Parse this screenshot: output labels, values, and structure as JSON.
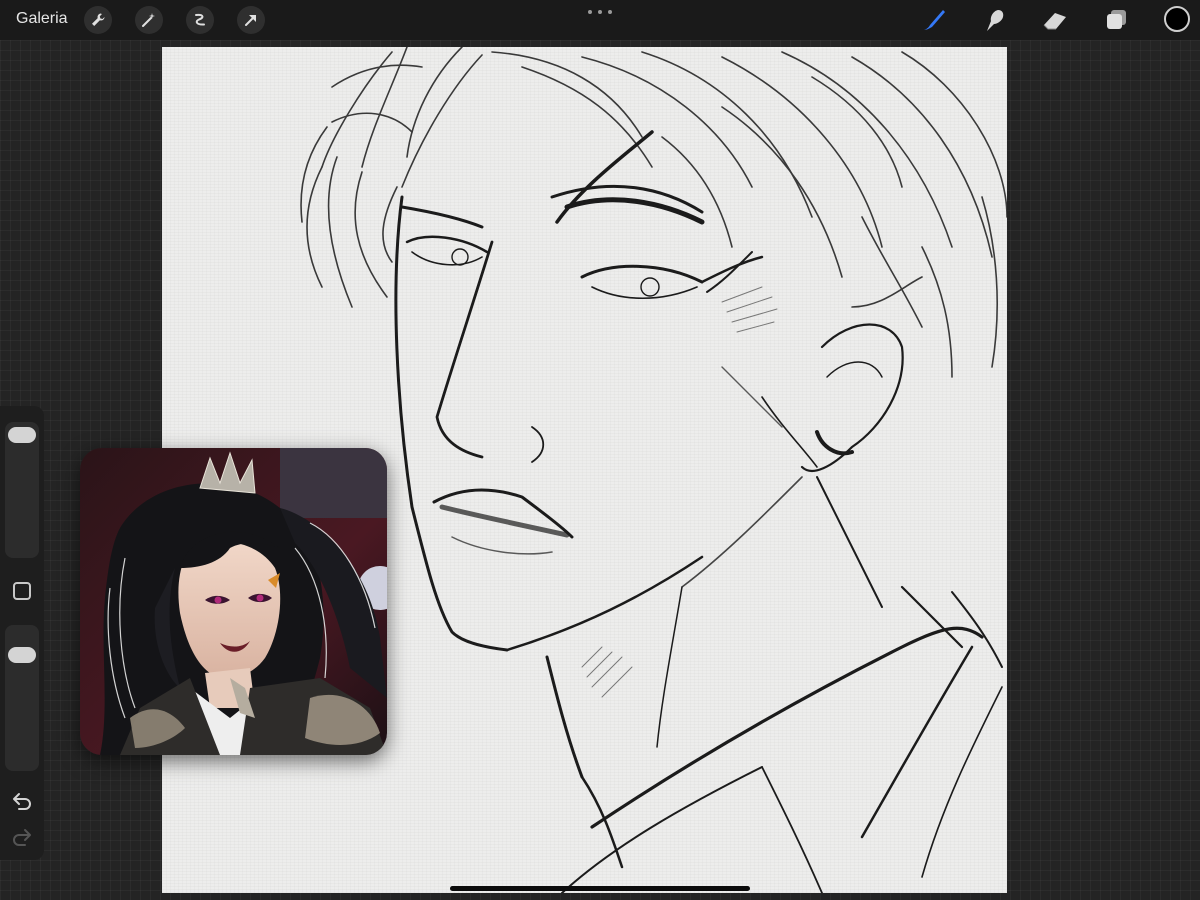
{
  "toolbar": {
    "gallery_label": "Galeria",
    "left_tools": [
      "wrench-icon",
      "magic-wand-icon",
      "selection-icon",
      "transform-arrow-icon"
    ],
    "right_tools": [
      "brush-icon",
      "smudge-icon",
      "eraser-icon",
      "layers-icon"
    ],
    "active_tool": "brush-icon",
    "active_color": "#000000",
    "accent_color": "#3478f6"
  },
  "sidebar": {
    "brush_size_level": 0.05,
    "opacity_level": 0.05,
    "controls": [
      "brush-size-slider",
      "modify-button",
      "opacity-slider",
      "undo-icon",
      "redo-icon"
    ]
  },
  "canvas": {
    "content": "pencil-sketch-portrait",
    "paper_color": "#ededec"
  },
  "reference": {
    "content": "reference-illustration"
  }
}
